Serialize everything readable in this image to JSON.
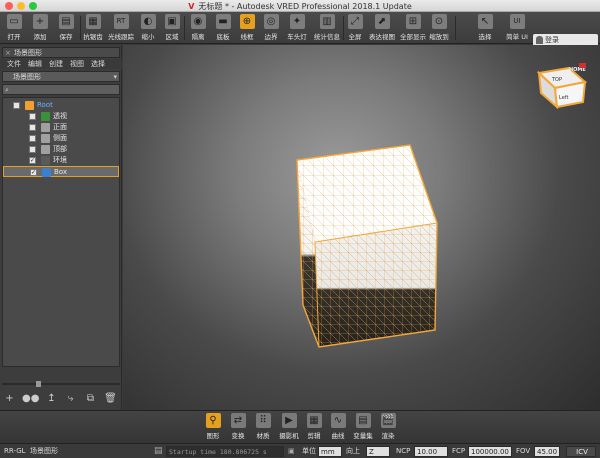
{
  "window": {
    "title": "无标题 * - Autodesk VRED Professional 2018.1 Update",
    "logo": "V"
  },
  "toolbar": {
    "items": [
      {
        "label": "打开",
        "icon": "folder-icon",
        "glyph": "▭"
      },
      {
        "label": "添加",
        "icon": "add-file-icon",
        "glyph": "+"
      },
      {
        "label": "保存",
        "icon": "save-icon",
        "glyph": "▤"
      },
      {
        "label": "抗锯齿",
        "icon": "antialias-icon",
        "glyph": "▦"
      },
      {
        "label": "光线跟踪",
        "icon": "raytrace-icon",
        "glyph": "RT"
      },
      {
        "label": "缩小",
        "icon": "shrink-icon",
        "glyph": "◐"
      },
      {
        "label": "区域",
        "icon": "region-icon",
        "glyph": "▣"
      },
      {
        "label": "隔离",
        "icon": "isolate-icon",
        "glyph": "◉"
      },
      {
        "label": "底板",
        "icon": "baseplate-icon",
        "glyph": "▬"
      },
      {
        "label": "线框",
        "icon": "wireframe-icon",
        "glyph": "⊕"
      },
      {
        "label": "边界",
        "icon": "boundary-icon",
        "glyph": "◎"
      },
      {
        "label": "车头灯",
        "icon": "headlight-icon",
        "glyph": "✦"
      },
      {
        "label": "统计信息",
        "icon": "statistics-icon",
        "glyph": "▥"
      },
      {
        "label": "全屏",
        "icon": "fullscreen-icon",
        "glyph": "⤢"
      },
      {
        "label": "表达视图",
        "icon": "expression-view-icon",
        "glyph": "⬈"
      },
      {
        "label": "全部显示",
        "icon": "show-all-icon",
        "glyph": "⊞"
      },
      {
        "label": "缩放到",
        "icon": "zoom-to-icon",
        "glyph": "⊙"
      },
      {
        "label": "选择",
        "icon": "select-icon",
        "glyph": "↖"
      },
      {
        "label": "简单 UI",
        "icon": "simple-ui-icon",
        "glyph": "UI"
      }
    ],
    "login": "登录"
  },
  "panel": {
    "tab_title": "场景图形",
    "menu": [
      "文件",
      "编辑",
      "创建",
      "视图",
      "选择"
    ],
    "combo": "场景图形",
    "search_placeholder": "",
    "tree": [
      {
        "label": "Root",
        "checked": false,
        "color": "#f0a030"
      },
      {
        "label": "透视",
        "checked": false,
        "color": "#3c8f3c"
      },
      {
        "label": "正面",
        "checked": false,
        "color": "#a0a0a0"
      },
      {
        "label": "侧面",
        "checked": false,
        "color": "#a0a0a0"
      },
      {
        "label": "顶部",
        "checked": false,
        "color": "#a0a0a0"
      },
      {
        "label": "环境",
        "checked": true,
        "color": "#5a5a5a"
      },
      {
        "label": "Box",
        "checked": true,
        "color": "#3a7fd0"
      }
    ],
    "slider_value": 0.3,
    "buttons": [
      "add-node-icon",
      "group-icon",
      "move-up-icon",
      "move-icon",
      "copy-icon",
      "delete-icon"
    ]
  },
  "viewport": {
    "cube_labels": {
      "top": "TOP",
      "left": "Left",
      "home": "HOME"
    },
    "cube_color": "#f2a73b"
  },
  "bottombar": {
    "items": [
      {
        "label": "图形",
        "icon": "scenegraph-icon",
        "glyph": "⚲"
      },
      {
        "label": "变换",
        "icon": "transform-icon",
        "glyph": "⇄"
      },
      {
        "label": "材质",
        "icon": "material-icon",
        "glyph": "⠿"
      },
      {
        "label": "摄影机",
        "icon": "camera-icon",
        "glyph": "▶"
      },
      {
        "label": "剪辑",
        "icon": "clip-icon",
        "glyph": "▦"
      },
      {
        "label": "曲线",
        "icon": "curve-icon",
        "glyph": "∿"
      },
      {
        "label": "变量集",
        "icon": "variant-set-icon",
        "glyph": "▤"
      },
      {
        "label": "渲染",
        "icon": "render-icon",
        "glyph": "🎬"
      }
    ]
  },
  "statusbar": {
    "renderer": "RR-GL",
    "context": "场景图形",
    "log": "Startup time 180.806725 s",
    "unit_label": "单位",
    "unit_value": "mm",
    "up_label": "向上",
    "up_value": "Z",
    "ncp_label": "NCP",
    "ncp_value": "10.00",
    "fcp_label": "FCP",
    "fcp_value": "100000.00",
    "fov_label": "FOV",
    "fov_value": "45.00",
    "icv_label": "ICV"
  }
}
